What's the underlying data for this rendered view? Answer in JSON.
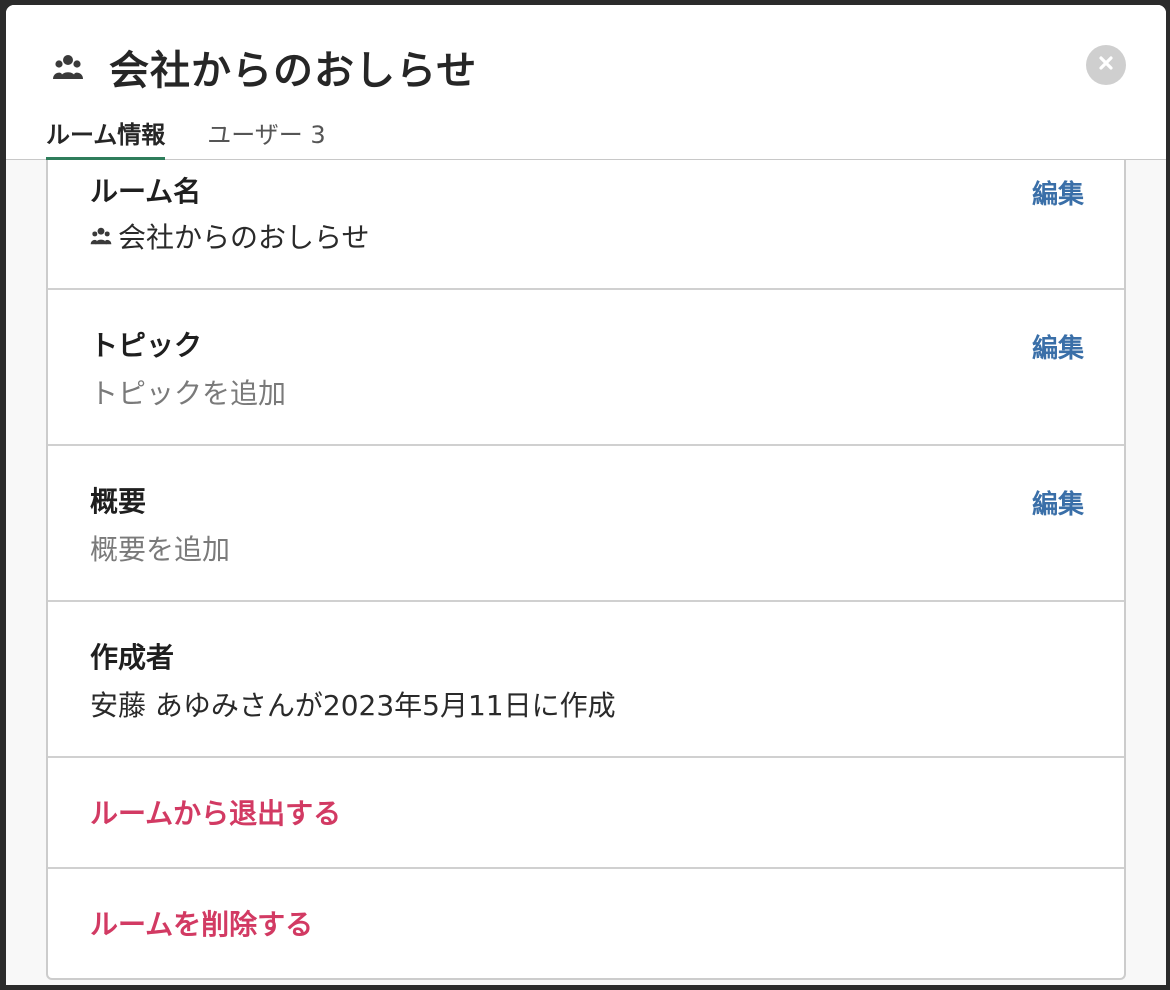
{
  "dialog": {
    "title": "会社からのおしらせ",
    "room_icon": "people-group-icon",
    "close_icon": "close-icon"
  },
  "tabs": [
    {
      "label": "ルーム情報",
      "active": true
    },
    {
      "label": "ユーザー 3",
      "active": false
    }
  ],
  "sections": {
    "room_name": {
      "label": "ルーム名",
      "value": "会社からのおしらせ",
      "edit": "編集"
    },
    "topic": {
      "label": "トピック",
      "placeholder": "トピックを追加",
      "edit": "編集"
    },
    "overview": {
      "label": "概要",
      "placeholder": "概要を追加",
      "edit": "編集"
    },
    "creator": {
      "label": "作成者",
      "value": "安藤 あゆみさんが2023年5月11日に作成"
    }
  },
  "actions": {
    "leave": "ルームから退出する",
    "delete": "ルームを削除する"
  },
  "colors": {
    "accent_tab": "#2e7d5b",
    "link": "#3a6fa8",
    "danger": "#d23a63"
  }
}
